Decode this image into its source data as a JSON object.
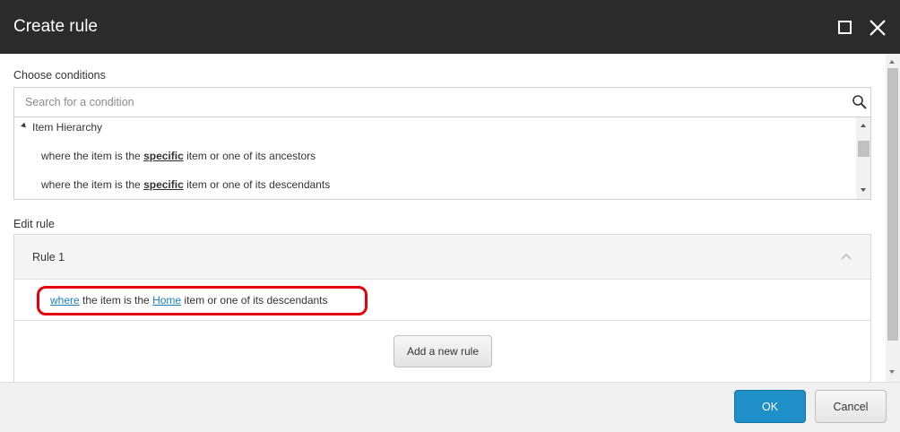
{
  "dialog": {
    "title": "Create rule"
  },
  "conditions": {
    "label": "Choose conditions",
    "search_placeholder": "Search for a condition",
    "group": "Item Hierarchy",
    "items": [
      {
        "before": "where the item is the ",
        "link": "specific",
        "after": " item or one of its ancestors"
      },
      {
        "before": "where the item is the ",
        "link": "specific",
        "after": " item or one of its descendants"
      }
    ]
  },
  "edit_rule": {
    "label": "Edit rule",
    "rule_title": "Rule 1",
    "rule_parts": {
      "link1": "where",
      "text1": " the item is the ",
      "link2": "Home",
      "text2": " item or one of its descendants"
    },
    "add_rule_label": "Add a new rule"
  },
  "footer": {
    "ok_label": "OK",
    "cancel_label": "Cancel"
  },
  "colors": {
    "titlebar": "#2b2b2b",
    "link": "#1b7fc0",
    "highlight": "#e3000f",
    "primary_button": "#1f8fc9"
  },
  "icons": {
    "maximize": "maximize-icon",
    "close": "close-icon",
    "search": "search-icon",
    "collapse": "chevron-up-icon",
    "expand_group": "triangle-expanded-icon"
  }
}
